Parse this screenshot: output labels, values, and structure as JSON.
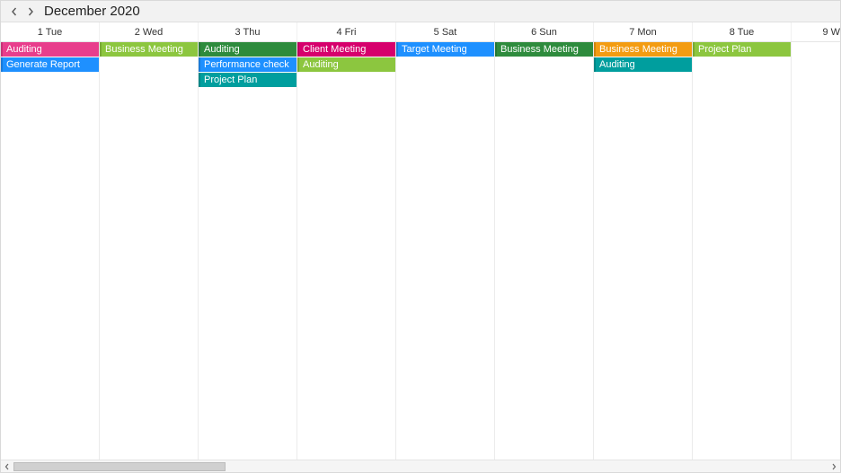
{
  "header": {
    "title": "December 2020"
  },
  "icons": {
    "prev": "chevron-left",
    "next": "chevron-right"
  },
  "days": [
    {
      "label": "1 Tue"
    },
    {
      "label": "2 Wed"
    },
    {
      "label": "3 Thu"
    },
    {
      "label": "4 Fri"
    },
    {
      "label": "5 Sat"
    },
    {
      "label": "6 Sun"
    },
    {
      "label": "7 Mon"
    },
    {
      "label": "8 Tue"
    },
    {
      "label": "9 W"
    }
  ],
  "colors": {
    "pink": "#e83e8c",
    "olive": "#8cc63f",
    "blue": "#1e90ff",
    "green": "#2e8b3d",
    "magenta": "#d6006c",
    "teal": "#009e9e",
    "orange": "#f39c12"
  },
  "events": {
    "0": [
      {
        "label": "Auditing",
        "color": "pink"
      },
      {
        "label": "Generate Report",
        "color": "blue"
      }
    ],
    "1": [
      {
        "label": "Business Meeting",
        "color": "olive"
      }
    ],
    "2": [
      {
        "label": "Auditing",
        "color": "green"
      },
      {
        "label": "Performance check",
        "color": "blue"
      },
      {
        "label": "Project Plan",
        "color": "teal"
      }
    ],
    "3": [
      {
        "label": "Client Meeting",
        "color": "magenta"
      },
      {
        "label": "Auditing",
        "color": "olive"
      }
    ],
    "4": [
      {
        "label": "Target Meeting",
        "color": "blue"
      }
    ],
    "5": [
      {
        "label": "Business Meeting",
        "color": "green"
      }
    ],
    "6": [
      {
        "label": "Business Meeting",
        "color": "orange"
      },
      {
        "label": "Auditing",
        "color": "teal"
      }
    ],
    "7": [
      {
        "label": "Project Plan",
        "color": "olive"
      }
    ],
    "8": []
  },
  "scrollbar": {
    "thumb_left_pct": 0,
    "thumb_width_pct": 26
  }
}
